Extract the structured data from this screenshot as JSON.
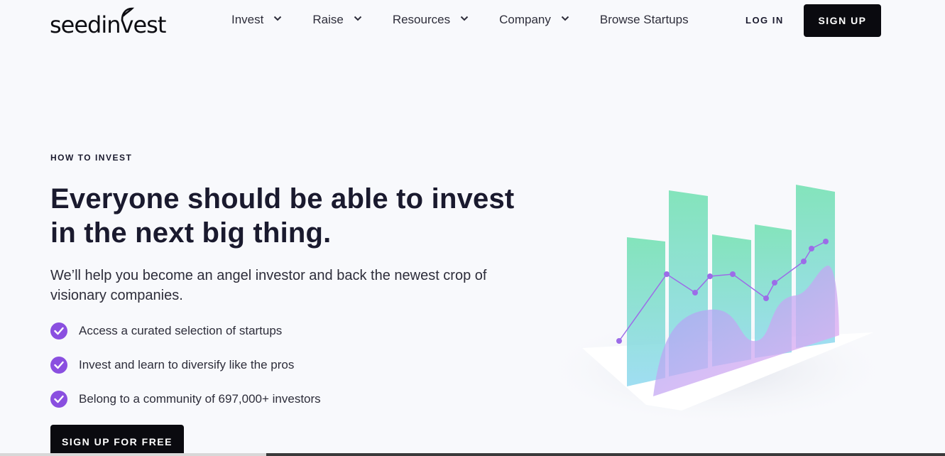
{
  "brand": {
    "logo_text": "seedinvest"
  },
  "nav": {
    "items": [
      {
        "label": "Invest",
        "has_dropdown": true
      },
      {
        "label": "Raise",
        "has_dropdown": true
      },
      {
        "label": "Resources",
        "has_dropdown": true
      },
      {
        "label": "Company",
        "has_dropdown": true
      },
      {
        "label": "Browse Startups",
        "has_dropdown": false
      }
    ],
    "login_label": "LOG IN",
    "signup_label": "SIGN UP"
  },
  "hero": {
    "eyebrow": "HOW TO INVEST",
    "headline_line1": "Everyone should be able to invest",
    "headline_line2": "in the next big thing.",
    "subtext": "We’ll help you become an angel investor and back the newest crop of visionary companies.",
    "features": [
      "Access a curated selection of startups",
      "Invest and learn to diversify like the pros",
      "Belong to a community of 697,000+ investors"
    ],
    "cta_label": "SIGN UP FOR FREE"
  },
  "colors": {
    "accent": "#8a4fe0",
    "button_bg": "#0a0a0f",
    "background": "#f8f9fc"
  },
  "icons": {
    "check": "check-circle-icon",
    "chevron": "chevron-down-icon"
  }
}
